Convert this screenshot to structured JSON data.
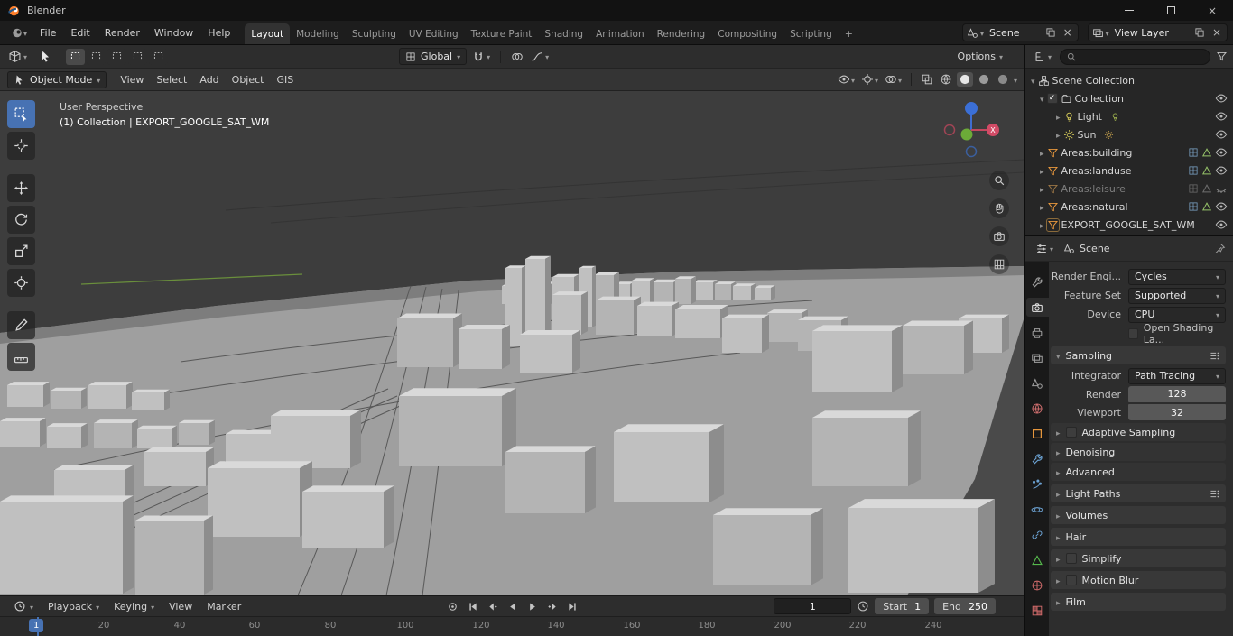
{
  "titlebar": {
    "title": "Blender"
  },
  "topbar": {
    "menus": [
      "File",
      "Edit",
      "Render",
      "Window",
      "Help"
    ],
    "workspaces": [
      "Layout",
      "Modeling",
      "Sculpting",
      "UV Editing",
      "Texture Paint",
      "Shading",
      "Animation",
      "Rendering",
      "Compositing",
      "Scripting"
    ],
    "add_workspace": "+",
    "scene_value": "Scene",
    "view_layer_value": "View Layer"
  },
  "tool_header": {
    "orientation_value": "Global",
    "options_label": "Options"
  },
  "vp_header": {
    "mode_value": "Object Mode",
    "menus": [
      "View",
      "Select",
      "Add",
      "Object",
      "GIS"
    ]
  },
  "viewport": {
    "overlay_line1": "User Perspective",
    "overlay_line2": "(1) Collection | EXPORT_GOOGLE_SAT_WM",
    "gizmo_x_label": "X"
  },
  "outliner": {
    "items": [
      {
        "label": "Scene Collection"
      },
      {
        "label": "Collection"
      },
      {
        "label": "Light"
      },
      {
        "label": "Sun"
      },
      {
        "label": "Areas:building"
      },
      {
        "label": "Areas:landuse"
      },
      {
        "label": "Areas:leisure"
      },
      {
        "label": "Areas:natural"
      },
      {
        "label": "EXPORT_GOOGLE_SAT_WM"
      }
    ]
  },
  "properties": {
    "breadcrumb": "Scene",
    "render_engine_label": "Render Engi...",
    "render_engine_value": "Cycles",
    "feature_set_label": "Feature Set",
    "feature_set_value": "Supported",
    "device_label": "Device",
    "device_value": "CPU",
    "osl_label": "Open Shading La...",
    "sampling_title": "Sampling",
    "integrator_label": "Integrator",
    "integrator_value": "Path Tracing",
    "render_label": "Render",
    "render_value": "128",
    "viewport_label": "Viewport",
    "viewport_value": "32",
    "adaptive_label": "Adaptive Sampling",
    "denoising_label": "Denoising",
    "advanced_label": "Advanced",
    "light_paths_label": "Light Paths",
    "volumes_label": "Volumes",
    "hair_label": "Hair",
    "simplify_label": "Simplify",
    "motion_blur_label": "Motion Blur",
    "film_label": "Film"
  },
  "timeline": {
    "menus": [
      "Playback",
      "Keying",
      "View",
      "Marker"
    ],
    "current_frame": "1",
    "start_label": "Start",
    "start_value": "1",
    "end_label": "End",
    "end_value": "250",
    "playhead_frame": "1",
    "ruler": [
      "20",
      "40",
      "60",
      "80",
      "100",
      "120",
      "140",
      "160",
      "180",
      "200",
      "220",
      "240"
    ]
  }
}
